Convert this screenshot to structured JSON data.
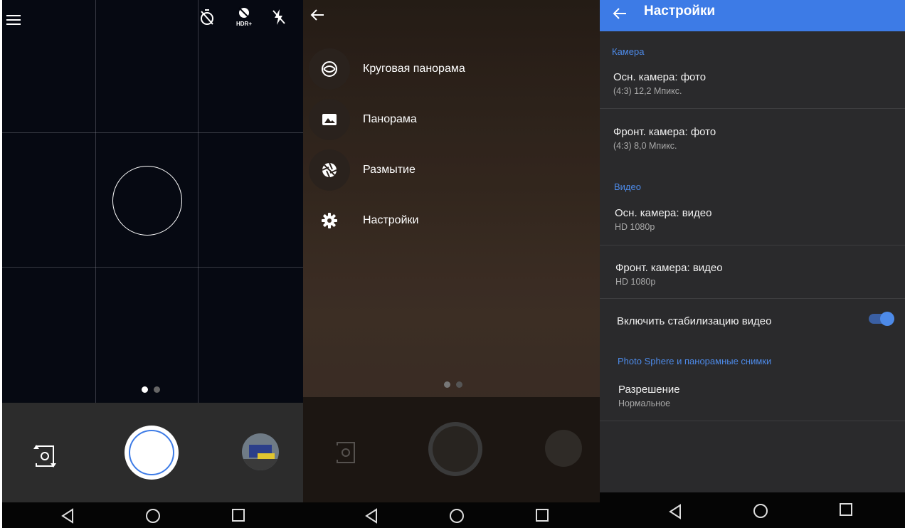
{
  "camera": {
    "top_icons": [
      "menu-icon",
      "timer-off-icon",
      "hdr-plus-icon",
      "flash-off-icon"
    ],
    "hdr_label": "HDR+",
    "page_dots": 2,
    "active_dot": 0
  },
  "menu": {
    "items": [
      {
        "label": "Круговая панорама",
        "icon": "photosphere-icon"
      },
      {
        "label": "Панорама",
        "icon": "panorama-icon"
      },
      {
        "label": "Размытие",
        "icon": "lens-blur-icon"
      },
      {
        "label": "Настройки",
        "icon": "gear-icon"
      }
    ]
  },
  "settings": {
    "title": "Настройки",
    "sections": {
      "camera": "Камера",
      "video": "Видео",
      "photosphere": "Photo Sphere и панорамные снимки"
    },
    "rows": {
      "rear_photo": {
        "title": "Осн. камера: фото",
        "value": "(4:3) 12,2 Мпикс."
      },
      "front_photo": {
        "title": "Фронт. камера: фото",
        "value": "(4:3) 8,0 Мпикс."
      },
      "rear_video": {
        "title": "Осн. камера: видео",
        "value": "HD 1080p"
      },
      "front_video": {
        "title": "Фронт. камера: видео",
        "value": "HD 1080p"
      },
      "stabilization": {
        "title": "Включить стабилизацию видео",
        "enabled": true
      },
      "resolution": {
        "title": "Разрешение",
        "value": "Нормальное"
      }
    }
  },
  "colors": {
    "accent": "#3d7be6",
    "section_text": "#4d8ae8",
    "settings_bg": "#2a2a2c"
  }
}
